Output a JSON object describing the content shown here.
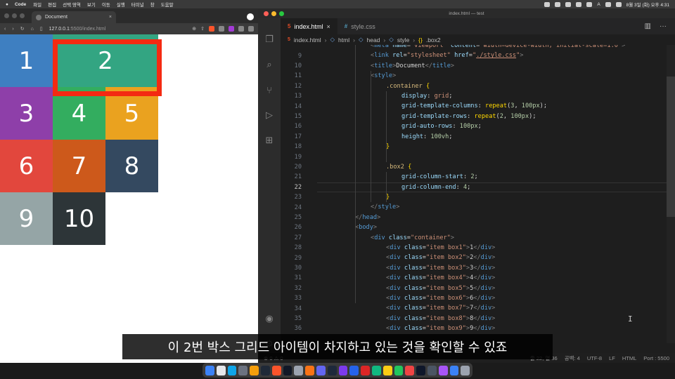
{
  "macbar": {
    "app": "Code",
    "menus": [
      "파일",
      "편집",
      "선택 영역",
      "보기",
      "이동",
      "실행",
      "터미널",
      "창",
      "도움말"
    ],
    "clock": "8월 3일 (화) 오후 4:31",
    "input_indicator": "A"
  },
  "browser": {
    "tab_title": "Document",
    "tab_close": "×",
    "url_host": "127.0.0.1",
    "url_rest": ":5500/index.html",
    "grid_items": [
      {
        "label": "1",
        "color": "#3e7fc1"
      },
      {
        "label": "2",
        "color": "#33a582"
      },
      {
        "label": "3",
        "color": "#8e3fa9"
      },
      {
        "label": "4",
        "color": "#33ad5f"
      },
      {
        "label": "5",
        "color": "#eaa21f"
      },
      {
        "label": "6",
        "color": "#e2473d"
      },
      {
        "label": "7",
        "color": "#cd591b"
      },
      {
        "label": "8",
        "color": "#344960"
      },
      {
        "label": "9",
        "color": "#95a5a6"
      },
      {
        "label": "10",
        "color": "#2d3538"
      }
    ],
    "highlight_color": "#f42a12"
  },
  "editor": {
    "window_title": "index.html — test",
    "tabs": [
      {
        "label": "index.html",
        "icon": "html-file-icon",
        "active": true
      },
      {
        "label": "style.css",
        "icon": "css-file-icon",
        "active": false
      }
    ],
    "tab_close": "×",
    "breadcrumbs": [
      "index.html",
      "html",
      "head",
      "style",
      ".box2"
    ],
    "current_line": "22",
    "code_lines": [
      {
        "n": "",
        "html": "<span class='b'>&lt;</span><span class='t'>meta</span> <span class='a'>name</span>=<span class='s'>\"viewport\"</span> <span class='a'>content</span>=<span class='s'>\"width=device-width, initial-scale=1.0\"</span><span class='b'>&gt;</span>",
        "indent": 3
      },
      {
        "n": "9",
        "html": "<span class='b'>&lt;</span><span class='t'>link</span> <span class='a'>rel</span>=<span class='s'>\"stylesheet\"</span> <span class='a'>href</span>=<span class='s'>\"<u>./style.css</u>\"</span><span class='b'>&gt;</span>",
        "indent": 3
      },
      {
        "n": "10",
        "html": "<span class='b'>&lt;</span><span class='t'>title</span><span class='b'>&gt;</span><span class='tx'>Document</span><span class='b'>&lt;/</span><span class='t'>title</span><span class='b'>&gt;</span>",
        "indent": 3
      },
      {
        "n": "11",
        "html": "<span class='b'>&lt;</span><span class='t'>style</span><span class='b'>&gt;</span>",
        "indent": 3
      },
      {
        "n": "12",
        "html": "<span class='sel'>.container</span> <span class='y'>{</span>",
        "indent": 4
      },
      {
        "n": "13",
        "html": "<span class='p'>display</span>: <span class='k'>grid</span>;",
        "indent": 5
      },
      {
        "n": "14",
        "html": "<span class='p'>grid-template-columns</span>: <span class='y'>repeat</span>(<span class='n'>3</span>, <span class='n'>100px</span>);",
        "indent": 5
      },
      {
        "n": "15",
        "html": "<span class='p'>grid-template-rows</span>: <span class='y'>repeat</span>(<span class='n'>2</span>, <span class='n'>100px</span>);",
        "indent": 5
      },
      {
        "n": "16",
        "html": "<span class='p'>grid-auto-rows</span>: <span class='n'>100px</span>;",
        "indent": 5
      },
      {
        "n": "17",
        "html": "<span class='p'>height</span>: <span class='n'>100vh</span>;",
        "indent": 5
      },
      {
        "n": "18",
        "html": "<span class='y'>}</span>",
        "indent": 4
      },
      {
        "n": "19",
        "html": "",
        "indent": 0
      },
      {
        "n": "20",
        "html": "<span class='sel'>.box2</span> <span class='y'>{</span>",
        "indent": 4
      },
      {
        "n": "21",
        "html": "<span class='p'>grid-column-start</span>: <span class='n'>2</span>;",
        "indent": 5
      },
      {
        "n": "22",
        "html": "<span class='p'>grid-column-end</span>: <span class='n'>4</span>;",
        "indent": 5
      },
      {
        "n": "23",
        "html": "<span class='y'>}</span>",
        "indent": 4
      },
      {
        "n": "24",
        "html": "<span class='b'>&lt;/</span><span class='t'>style</span><span class='b'>&gt;</span>",
        "indent": 3
      },
      {
        "n": "25",
        "html": "<span class='b'>&lt;/</span><span class='t'>head</span><span class='b'>&gt;</span>",
        "indent": 2
      },
      {
        "n": "26",
        "html": "<span class='b'>&lt;</span><span class='t'>body</span><span class='b'>&gt;</span>",
        "indent": 2
      },
      {
        "n": "27",
        "html": "<span class='b'>&lt;</span><span class='t'>div</span> <span class='a'>class</span>=<span class='s'>\"container\"</span><span class='b'>&gt;</span>",
        "indent": 3
      },
      {
        "n": "28",
        "html": "<span class='b'>&lt;</span><span class='t'>div</span> <span class='a'>class</span>=<span class='s'>\"item box1\"</span><span class='b'>&gt;</span><span class='tx'>1</span><span class='b'>&lt;/</span><span class='t'>div</span><span class='b'>&gt;</span>",
        "indent": 4
      },
      {
        "n": "29",
        "html": "<span class='b'>&lt;</span><span class='t'>div</span> <span class='a'>class</span>=<span class='s'>\"item box2\"</span><span class='b'>&gt;</span><span class='tx'>2</span><span class='b'>&lt;/</span><span class='t'>div</span><span class='b'>&gt;</span>",
        "indent": 4
      },
      {
        "n": "30",
        "html": "<span class='b'>&lt;</span><span class='t'>div</span> <span class='a'>class</span>=<span class='s'>\"item box3\"</span><span class='b'>&gt;</span><span class='tx'>3</span><span class='b'>&lt;/</span><span class='t'>div</span><span class='b'>&gt;</span>",
        "indent": 4
      },
      {
        "n": "31",
        "html": "<span class='b'>&lt;</span><span class='t'>div</span> <span class='a'>class</span>=<span class='s'>\"item box4\"</span><span class='b'>&gt;</span><span class='tx'>4</span><span class='b'>&lt;/</span><span class='t'>div</span><span class='b'>&gt;</span>",
        "indent": 4
      },
      {
        "n": "32",
        "html": "<span class='b'>&lt;</span><span class='t'>div</span> <span class='a'>class</span>=<span class='s'>\"item box5\"</span><span class='b'>&gt;</span><span class='tx'>5</span><span class='b'>&lt;/</span><span class='t'>div</span><span class='b'>&gt;</span>",
        "indent": 4
      },
      {
        "n": "33",
        "html": "<span class='b'>&lt;</span><span class='t'>div</span> <span class='a'>class</span>=<span class='s'>\"item box6\"</span><span class='b'>&gt;</span><span class='tx'>6</span><span class='b'>&lt;/</span><span class='t'>div</span><span class='b'>&gt;</span>",
        "indent": 4
      },
      {
        "n": "34",
        "html": "<span class='b'>&lt;</span><span class='t'>div</span> <span class='a'>class</span>=<span class='s'>\"item box7\"</span><span class='b'>&gt;</span><span class='tx'>7</span><span class='b'>&lt;/</span><span class='t'>div</span><span class='b'>&gt;</span>",
        "indent": 4
      },
      {
        "n": "35",
        "html": "<span class='b'>&lt;</span><span class='t'>div</span> <span class='a'>class</span>=<span class='s'>\"item box8\"</span><span class='b'>&gt;</span><span class='tx'>8</span><span class='b'>&lt;/</span><span class='t'>div</span><span class='b'>&gt;</span>",
        "indent": 4
      },
      {
        "n": "36",
        "html": "<span class='b'>&lt;</span><span class='t'>div</span> <span class='a'>class</span>=<span class='s'>\"item box9\"</span><span class='b'>&gt;</span><span class='tx'>9</span><span class='b'>&lt;/</span><span class='t'>div</span><span class='b'>&gt;</span>",
        "indent": 4
      }
    ],
    "status": {
      "left": "⊗ 0 ⚠ 0",
      "position": "줄 22, 열 36",
      "spaces": "공백: 4",
      "encoding": "UTF-8",
      "eol": "LF",
      "language": "HTML",
      "port": "Port : 5500"
    }
  },
  "subtitle": "이 2번 박스 그리드 아이템이 차지하고 있는 것을 확인할 수 있죠",
  "dock_colors": [
    "#3b82f6",
    "#e5e7eb",
    "#0ea5e9",
    "#6b7280",
    "#f59e0b",
    "#1f2937",
    "#fb542b",
    "#111827",
    "#9ca3af",
    "#f97316",
    "#6366f1",
    "#1e293b",
    "#7c3aed",
    "#2563eb",
    "#dc2626",
    "#10b981",
    "#facc15",
    "#22c55e",
    "#ef4444",
    "#0f172a",
    "#4b5563",
    "#a855f7",
    "#3b82f6",
    "#9ca3af"
  ]
}
